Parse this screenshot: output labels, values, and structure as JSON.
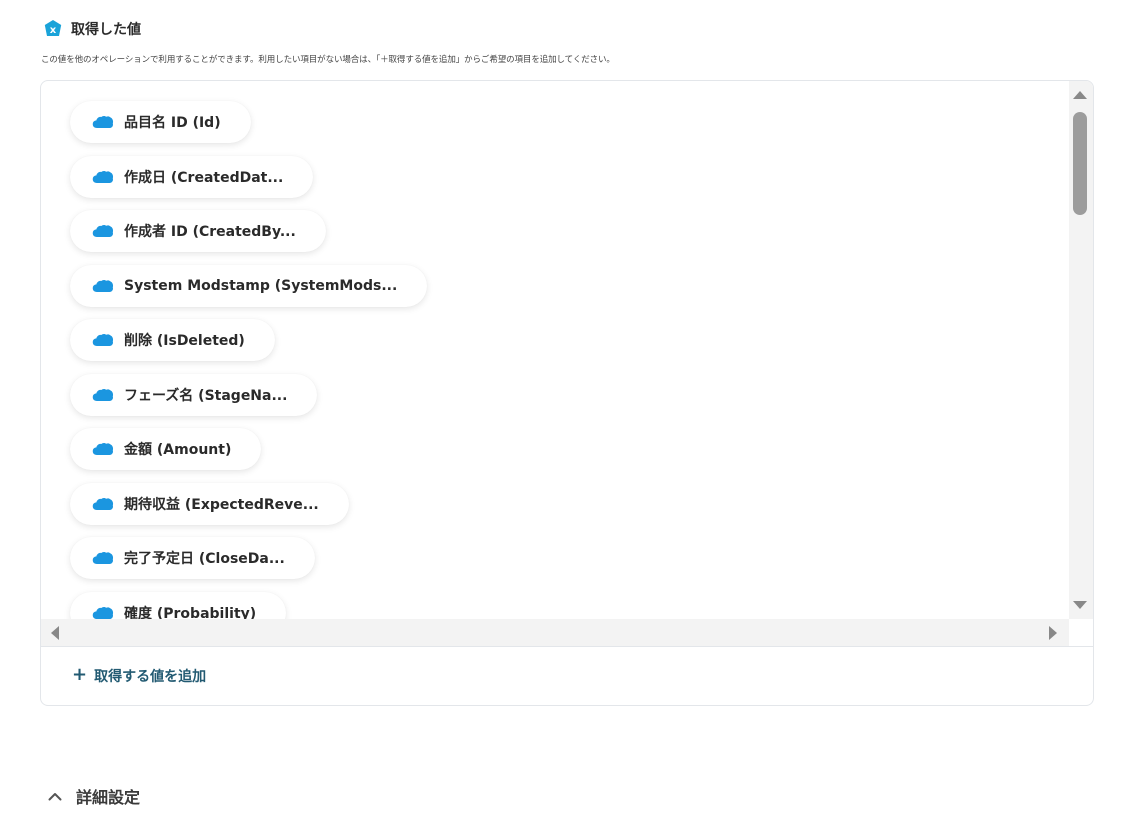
{
  "section": {
    "title": "取得した値",
    "description": "この値を他のオペレーションで利用することができます。利用したい項目がない場合は、「＋取得する値を追加」からご希望の項目を追加してください。"
  },
  "fields": [
    {
      "label": "品目名 ID (Id)",
      "icon": "salesforce-cloud-icon"
    },
    {
      "label": "作成日 (CreatedDat...",
      "icon": "salesforce-cloud-icon"
    },
    {
      "label": "作成者 ID (CreatedBy...",
      "icon": "salesforce-cloud-icon"
    },
    {
      "label": "System Modstamp (SystemMods...",
      "icon": "salesforce-cloud-icon"
    },
    {
      "label": "削除 (IsDeleted)",
      "icon": "salesforce-cloud-icon"
    },
    {
      "label": "フェーズ名 (StageNa...",
      "icon": "salesforce-cloud-icon"
    },
    {
      "label": "金額 (Amount)",
      "icon": "salesforce-cloud-icon"
    },
    {
      "label": "期待収益 (ExpectedReve...",
      "icon": "salesforce-cloud-icon"
    },
    {
      "label": "完了予定日 (CloseDa...",
      "icon": "salesforce-cloud-icon"
    },
    {
      "label": "確度 (Probability)",
      "icon": "salesforce-cloud-icon"
    }
  ],
  "add_button": {
    "icon": "plus-icon",
    "label": "取得する値を追加"
  },
  "advanced": {
    "icon": "chevron-up-icon",
    "label": "詳細設定"
  },
  "colors": {
    "accent": "#1aa3d9",
    "cloud": "#1b96e0",
    "link": "#225a72"
  }
}
